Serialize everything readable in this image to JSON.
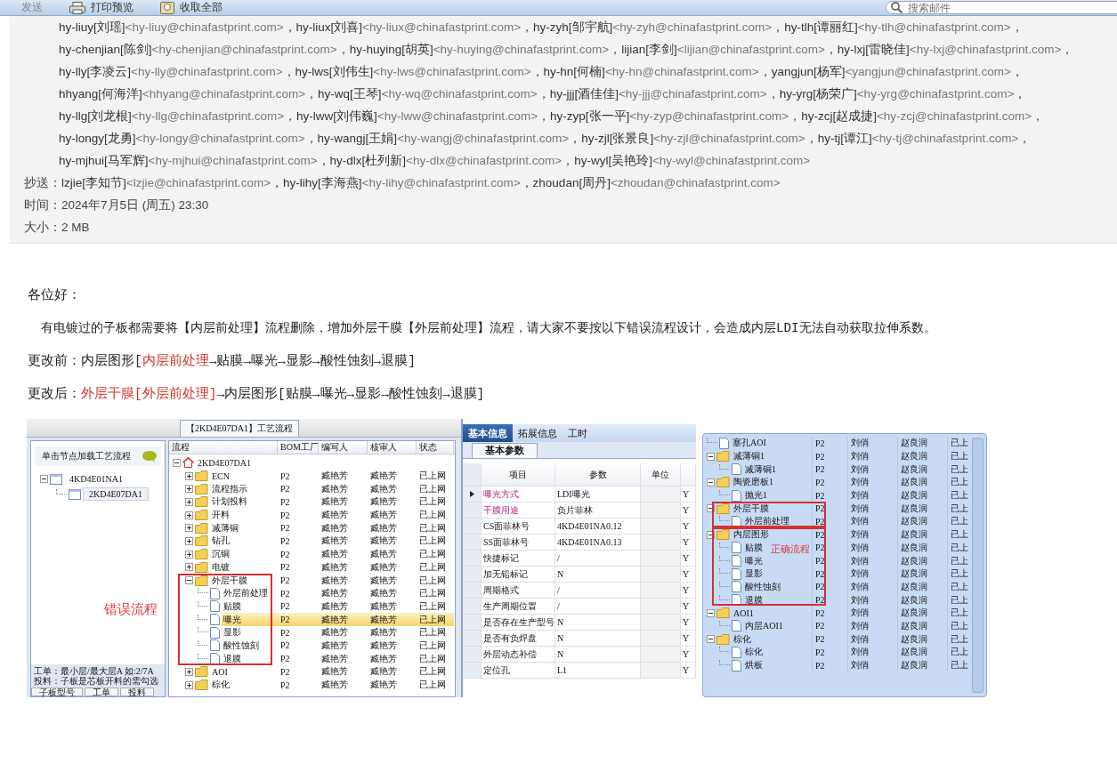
{
  "toolbar": {
    "items": [
      {
        "label": "发送",
        "kind": "plain"
      },
      {
        "label": "打印预览",
        "kind": "print"
      },
      {
        "label": "收取全部",
        "kind": "fetch"
      }
    ],
    "search": {
      "placeholder": "搜索邮件"
    }
  },
  "header": {
    "recipient_lines": [
      [
        {
          "name": "hy-liuy[刘瑶]",
          "address": "<hy-liuy@chinafastprint.com>",
          "separator": "，"
        },
        {
          "name": "hy-liux[刘喜]",
          "address": "<hy-liux@chinafastprint.com>",
          "separator": "，"
        },
        {
          "name": "hy-zyh[邹宇航]",
          "address": "<hy-zyh@chinafastprint.com>",
          "separator": "，"
        },
        {
          "name": "hy-tlh[谭丽红]",
          "address": "<hy-tlh@chinafastprint.com>",
          "separator": "，"
        }
      ],
      [
        {
          "name": "hy-chenjian[陈剑]",
          "address": "<hy-chenjian@chinafastprint.com>",
          "separator": "，"
        },
        {
          "name": "hy-huying[胡英]",
          "address": "<hy-huying@chinafastprint.com>",
          "separator": "，"
        },
        {
          "name": "lijian[李剑]",
          "address": "<lijian@chinafastprint.com>",
          "separator": "，"
        },
        {
          "name": "hy-lxj[雷晓佳]",
          "address": "<hy-lxj@chinafastprint.com>",
          "separator": "，"
        }
      ],
      [
        {
          "name": "hy-lly[李凌云]",
          "address": "<hy-lly@chinafastprint.com>",
          "separator": "，"
        },
        {
          "name": "hy-lws[刘伟生]",
          "address": "<hy-lws@chinafastprint.com>",
          "separator": "，"
        },
        {
          "name": "hy-hn[何楠]",
          "address": "<hy-hn@chinafastprint.com>",
          "separator": "，"
        },
        {
          "name": "yangjun[杨军]",
          "address": "<yangjun@chinafastprint.com>",
          "separator": "，"
        }
      ],
      [
        {
          "name": "hhyang[何海洋]",
          "address": "<hhyang@chinafastprint.com>",
          "separator": "，"
        },
        {
          "name": "hy-wq[王琴]",
          "address": "<hy-wq@chinafastprint.com>",
          "separator": "，"
        },
        {
          "name": "hy-jjj[酒佳佳]",
          "address": "<hy-jjj@chinafastprint.com>",
          "separator": "，"
        },
        {
          "name": "hy-yrg[杨荣广]",
          "address": "<hy-yrg@chinafastprint.com>",
          "separator": "，"
        }
      ],
      [
        {
          "name": "hy-llg[刘龙根]",
          "address": "<hy-llg@chinafastprint.com>",
          "separator": "，"
        },
        {
          "name": "hy-lww[刘伟巍]",
          "address": "<hy-lww@chinafastprint.com>",
          "separator": "，"
        },
        {
          "name": "hy-zyp[张一平]",
          "address": "<hy-zyp@chinafastprint.com>",
          "separator": "，"
        },
        {
          "name": "hy-zcj[赵成捷]",
          "address": "<hy-zcj@chinafastprint.com>",
          "separator": "，"
        }
      ],
      [
        {
          "name": "hy-longy[龙勇]",
          "address": "<hy-longy@chinafastprint.com>",
          "separator": "，"
        },
        {
          "name": "hy-wangj[王娟]",
          "address": "<hy-wangj@chinafastprint.com>",
          "separator": "，"
        },
        {
          "name": "hy-zjl[张景良]",
          "address": "<hy-zjl@chinafastprint.com>",
          "separator": "，"
        },
        {
          "name": "hy-tj[谭江]",
          "address": "<hy-tj@chinafastprint.com>",
          "separator": "，"
        }
      ],
      [
        {
          "name": "hy-mjhui[马军辉]",
          "address": "<hy-mjhui@chinafastprint.com>",
          "separator": "，"
        },
        {
          "name": "hy-dlx[杜列新]",
          "address": "<hy-dlx@chinafastprint.com>",
          "separator": "，"
        },
        {
          "name": "hy-wyl[吴艳玲]",
          "address": "<hy-wyl@chinafastprint.com>"
        }
      ]
    ],
    "cc": {
      "label": "抄送：",
      "recipients": [
        {
          "name": "lzjie[李知节]",
          "address": "<lzjie@chinafastprint.com>",
          "separator": "，"
        },
        {
          "name": "hy-lihy[李海燕]",
          "address": "<hy-lihy@chinafastprint.com>",
          "separator": "，"
        },
        {
          "name": "zhoudan[周丹]",
          "address": "<zhoudan@chinafastprint.com>"
        }
      ]
    },
    "time": {
      "label": "时间：",
      "value": "2024年7月5日 (周五) 23:30"
    },
    "size": {
      "label": "大小：",
      "value": "2 MB"
    }
  },
  "body": {
    "greeting": "各位好：",
    "paragraph": "有电镀过的子板都需要将【内层前处理】流程删除，增加外层干膜【外层前处理】流程，请大家不要按以下错误流程设计，会造成内层LDI无法自动获取拉伸系数。",
    "change_lines": [
      {
        "segments": [
          {
            "text": "更改前：内层图形[",
            "highlighted": false
          },
          {
            "text": "内层前处理",
            "highlighted": true
          },
          {
            "text": "→贴膜→曝光→显影→酸性蚀刻→退膜]",
            "highlighted": false
          }
        ]
      },
      {
        "segments": [
          {
            "text": "更改后：",
            "highlighted": false
          },
          {
            "text": "外层干膜[外层前处理]",
            "highlighted": true
          },
          {
            "text": "→内层图形[贴膜→曝光→显影→酸性蚀刻→退膜]",
            "highlighted": false
          }
        ]
      }
    ]
  },
  "screenshots": [
    {
      "kind": "process_window",
      "tab": "【2KD4E07DA1】工艺流程",
      "panel_title": "单击节点加载工艺流程",
      "left_tree": [
        {
          "label": "4KD4E01NA1",
          "expanded": true,
          "selected": false,
          "children": [
            {
              "label": "2KD4E07DA1",
              "selected": true
            }
          ]
        }
      ],
      "annotation": "错误流程",
      "notes": [
        "工单：最小层/最大层A 如:2/7A",
        "投料：子板是芯板开料的需勾选"
      ],
      "bottom_tabs": [
        "子板型号",
        "工单",
        "投料"
      ],
      "columns": [
        "流程",
        "BOM工厂",
        "编写人",
        "核审人",
        "状态"
      ],
      "tree": [
        {
          "label": "2KD4E07DA1",
          "kind": "root",
          "expanded": true,
          "selected": false,
          "children": [
            {
              "label": "ECN",
              "kind": "folder",
              "expanded": false,
              "selected": false,
              "cells": [
                "P2",
                "臧艳芳",
                "臧艳芳",
                "已上网"
              ]
            },
            {
              "label": "流程指示",
              "kind": "folder",
              "expanded": false,
              "selected": false,
              "cells": [
                "P2",
                "臧艳芳",
                "臧艳芳",
                "已上网"
              ]
            },
            {
              "label": "计划投料",
              "kind": "folder",
              "expanded": false,
              "selected": false,
              "cells": [
                "P2",
                "臧艳芳",
                "臧艳芳",
                "已上网"
              ]
            },
            {
              "label": "开料",
              "kind": "folder",
              "expanded": false,
              "selected": false,
              "cells": [
                "P2",
                "臧艳芳",
                "臧艳芳",
                "已上网"
              ]
            },
            {
              "label": "减薄铜",
              "kind": "folder",
              "expanded": false,
              "selected": false,
              "cells": [
                "P2",
                "臧艳芳",
                "臧艳芳",
                "已上网"
              ]
            },
            {
              "label": "钻孔",
              "kind": "folder",
              "expanded": false,
              "selected": false,
              "cells": [
                "P2",
                "臧艳芳",
                "臧艳芳",
                "已上网"
              ]
            },
            {
              "label": "沉铜",
              "kind": "folder",
              "expanded": false,
              "selected": false,
              "cells": [
                "P2",
                "臧艳芳",
                "臧艳芳",
                "已上网"
              ]
            },
            {
              "label": "电镀",
              "kind": "folder",
              "expanded": false,
              "selected": false,
              "cells": [
                "P2",
                "臧艳芳",
                "臧艳芳",
                "已上网"
              ]
            },
            {
              "label": "外层干膜",
              "kind": "folder",
              "expanded": true,
              "selected": false,
              "boxed": true,
              "cells": [
                "P2",
                "臧艳芳",
                "臧艳芳",
                "已上网"
              ],
              "children": [
                {
                  "label": "外层前处理",
                  "kind": "file",
                  "selected": false,
                  "cells": [
                    "P2",
                    "臧艳芳",
                    "臧艳芳",
                    "已上网"
                  ]
                },
                {
                  "label": "贴膜",
                  "kind": "file",
                  "selected": false,
                  "cells": [
                    "P2",
                    "臧艳芳",
                    "臧艳芳",
                    "已上网"
                  ]
                },
                {
                  "label": "曝光",
                  "kind": "file",
                  "selected": true,
                  "cells": [
                    "P2",
                    "臧艳芳",
                    "臧艳芳",
                    "已上网"
                  ]
                },
                {
                  "label": "显影",
                  "kind": "file",
                  "selected": false,
                  "cells": [
                    "P2",
                    "臧艳芳",
                    "臧艳芳",
                    "已上网"
                  ]
                },
                {
                  "label": "酸性蚀刻",
                  "kind": "file",
                  "selected": false,
                  "cells": [
                    "P2",
                    "臧艳芳",
                    "臧艳芳",
                    "已上网"
                  ]
                },
                {
                  "label": "退膜",
                  "kind": "file",
                  "selected": false,
                  "cells": [
                    "P2",
                    "臧艳芳",
                    "臧艳芳",
                    "已上网"
                  ]
                }
              ]
            },
            {
              "label": "AOI",
              "kind": "folder",
              "expanded": false,
              "selected": false,
              "cells": [
                "P2",
                "臧艳芳",
                "臧艳芳",
                "已上网"
              ]
            },
            {
              "label": "棕化",
              "kind": "folder",
              "expanded": false,
              "selected": false,
              "cells": [
                "P2",
                "臧艳芳",
                "臧艳芳",
                "已上网"
              ]
            }
          ]
        }
      ]
    },
    {
      "kind": "parameter_panel",
      "tabs": [
        {
          "label": "基本信息",
          "selected": true
        },
        {
          "label": "拓展信息",
          "selected": false
        },
        {
          "label": "工时",
          "selected": false
        }
      ],
      "subtab": "基本参数",
      "columns": [
        "项目",
        "参数",
        "单位"
      ],
      "rows": [
        {
          "item": "曝光方式",
          "value": "LDI曝光",
          "flag": "Y",
          "emphasis": true,
          "selected": true
        },
        {
          "item": "干膜用途",
          "value": "负片菲林",
          "flag": "Y",
          "emphasis": true,
          "selected": false
        },
        {
          "item": "CS面菲林号",
          "value": "4KD4E01NA0.12",
          "flag": "Y",
          "emphasis": false,
          "selected": false
        },
        {
          "item": "SS面菲林号",
          "value": "4KD4E01NA0.13",
          "flag": "Y",
          "emphasis": false,
          "selected": false
        },
        {
          "item": "快捷标记",
          "value": "/",
          "flag": "Y",
          "emphasis": false,
          "selected": false
        },
        {
          "item": "加无铅标记",
          "value": "N",
          "flag": "Y",
          "emphasis": false,
          "selected": false
        },
        {
          "item": "周期格式",
          "value": "/",
          "flag": "Y",
          "emphasis": false,
          "selected": false
        },
        {
          "item": "生产周期位置",
          "value": "/",
          "flag": "Y",
          "emphasis": false,
          "selected": false
        },
        {
          "item": "是否存在生产型号",
          "value": "N",
          "flag": "Y",
          "emphasis": false,
          "selected": false
        },
        {
          "item": "是否有负焊盘",
          "value": "N",
          "flag": "Y",
          "emphasis": false,
          "selected": false
        },
        {
          "item": "外层动态补偿",
          "value": "N",
          "flag": "Y",
          "emphasis": false,
          "selected": false
        },
        {
          "item": "定位孔",
          "value": "L1",
          "flag": "Y",
          "emphasis": false,
          "selected": false
        }
      ]
    },
    {
      "kind": "process_tree",
      "annotation": "正确流程",
      "tree": [
        {
          "label": "塞孔AOI",
          "kind": "file",
          "cells": [
            "P2",
            "刘俏",
            "赵良润",
            "已上"
          ]
        },
        {
          "label": "减薄铜1",
          "kind": "folder",
          "expanded": true,
          "cells": [
            "P2",
            "刘俏",
            "赵良润",
            "已上"
          ],
          "children": [
            {
              "label": "减薄铜1",
              "kind": "file",
              "cells": [
                "P2",
                "刘俏",
                "赵良润",
                "已上"
              ]
            }
          ]
        },
        {
          "label": "陶瓷磨板1",
          "kind": "folder",
          "expanded": true,
          "cells": [
            "P2",
            "刘俏",
            "赵良润",
            "已上"
          ],
          "children": [
            {
              "label": "抛光1",
              "kind": "file",
              "cells": [
                "P2",
                "刘俏",
                "赵良润",
                "已上"
              ]
            }
          ]
        },
        {
          "label": "外层干膜",
          "kind": "folder",
          "expanded": true,
          "boxed": true,
          "cells": [
            "P2",
            "刘俏",
            "赵良润",
            "已上"
          ],
          "children": [
            {
              "label": "外层前处理",
              "kind": "file",
              "cells": [
                "P2",
                "刘俏",
                "赵良润",
                "已上"
              ]
            }
          ]
        },
        {
          "label": "内层图形",
          "kind": "folder",
          "expanded": true,
          "boxed": true,
          "cells": [
            "P2",
            "刘俏",
            "赵良润",
            "已上"
          ],
          "children": [
            {
              "label": "贴膜",
              "kind": "file",
              "cells": [
                "P2",
                "刘俏",
                "赵良润",
                "已上"
              ]
            },
            {
              "label": "曝光",
              "kind": "file",
              "cells": [
                "P2",
                "刘俏",
                "赵良润",
                "已上"
              ]
            },
            {
              "label": "显影",
              "kind": "file",
              "cells": [
                "P2",
                "刘俏",
                "赵良润",
                "已上"
              ]
            },
            {
              "label": "酸性蚀刻",
              "kind": "file",
              "cells": [
                "P2",
                "刘俏",
                "赵良润",
                "已上"
              ]
            },
            {
              "label": "退膜",
              "kind": "file",
              "cells": [
                "P2",
                "刘俏",
                "赵良润",
                "已上"
              ]
            }
          ]
        },
        {
          "label": "AOI1",
          "kind": "folder",
          "expanded": true,
          "cells": [
            "P2",
            "刘俏",
            "赵良润",
            "已上"
          ],
          "children": [
            {
              "label": "内层AOI1",
              "kind": "file",
              "cells": [
                "P2",
                "刘俏",
                "赵良润",
                "已上"
              ]
            }
          ]
        },
        {
          "label": "棕化",
          "kind": "folder",
          "expanded": true,
          "cells": [
            "P2",
            "刘俏",
            "赵良润",
            "已上"
          ],
          "children": [
            {
              "label": "棕化",
              "kind": "file",
              "cells": [
                "P2",
                "刘俏",
                "赵良润",
                "已上"
              ]
            },
            {
              "label": "烘板",
              "kind": "file",
              "cells": [
                "P2",
                "刘俏",
                "赵良润",
                "已上"
              ]
            }
          ]
        }
      ]
    }
  ]
}
